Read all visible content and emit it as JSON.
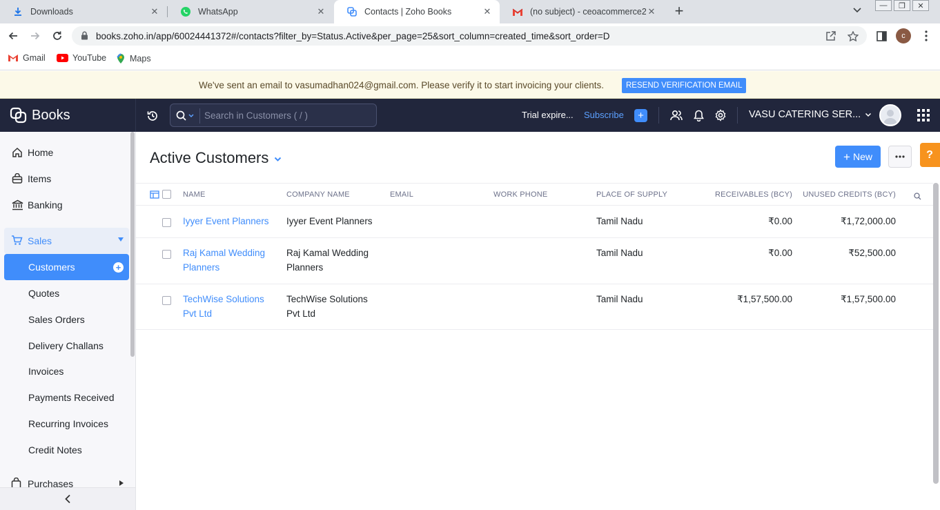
{
  "browser": {
    "tabs": [
      {
        "title": "Downloads",
        "icon": "download-icon"
      },
      {
        "title": "WhatsApp",
        "icon": "whatsapp-icon"
      },
      {
        "title": "Contacts | Zoho Books",
        "icon": "zoho-books-icon",
        "active": true
      },
      {
        "title": "(no subject) - ceoacommerce202",
        "icon": "gmail-icon"
      }
    ],
    "url": "books.zoho.in/app/60024441372#/contacts?filter_by=Status.Active&per_page=25&sort_column=created_time&sort_order=D",
    "profile_initial": "c",
    "bookmarks": [
      {
        "label": "Gmail",
        "icon": "gmail-icon"
      },
      {
        "label": "YouTube",
        "icon": "youtube-icon"
      },
      {
        "label": "Maps",
        "icon": "maps-icon"
      }
    ]
  },
  "banner": {
    "message": "We've sent an email to vasumadhan024@gmail.com. Please verify it to start invoicing your clients.",
    "button": "RESEND VERIFICATION EMAIL"
  },
  "header": {
    "brand": "Books",
    "search_placeholder": "Search in Customers ( / )",
    "trial": "Trial expire...",
    "subscribe": "Subscribe",
    "org_name": "VASU CATERING SER..."
  },
  "sidebar": {
    "home": "Home",
    "items": "Items",
    "banking": "Banking",
    "sales": "Sales",
    "sales_items": [
      "Customers",
      "Quotes",
      "Sales Orders",
      "Delivery Challans",
      "Invoices",
      "Payments Received",
      "Recurring Invoices",
      "Credit Notes"
    ],
    "purchases": "Purchases"
  },
  "main": {
    "title": "Active Customers",
    "new_button": "New",
    "help": "?",
    "columns": {
      "name": "NAME",
      "company": "COMPANY NAME",
      "email": "EMAIL",
      "phone": "WORK PHONE",
      "supply": "PLACE OF SUPPLY",
      "receivables": "RECEIVABLES (BCY)",
      "credits": "UNUSED CREDITS (BCY)"
    },
    "rows": [
      {
        "name": "Iyyer Event Planners",
        "company": "Iyyer Event Planners",
        "email": "",
        "phone": "",
        "supply": "Tamil Nadu",
        "receivables": "₹0.00",
        "credits": "₹1,72,000.00"
      },
      {
        "name": "Raj Kamal Wedding Planners",
        "company": "Raj Kamal Wedding Planners",
        "email": "",
        "phone": "",
        "supply": "Tamil Nadu",
        "receivables": "₹0.00",
        "credits": "₹52,500.00"
      },
      {
        "name": "TechWise Solutions Pvt Ltd",
        "company": "TechWise Solutions Pvt Ltd",
        "email": "",
        "phone": "",
        "supply": "Tamil Nadu",
        "receivables": "₹1,57,500.00",
        "credits": "₹1,57,500.00"
      }
    ]
  },
  "colors": {
    "accent": "#408dfb",
    "header_bg": "#21263c",
    "banner_bg": "#fcf9e8",
    "help_orange": "#f7931e"
  }
}
